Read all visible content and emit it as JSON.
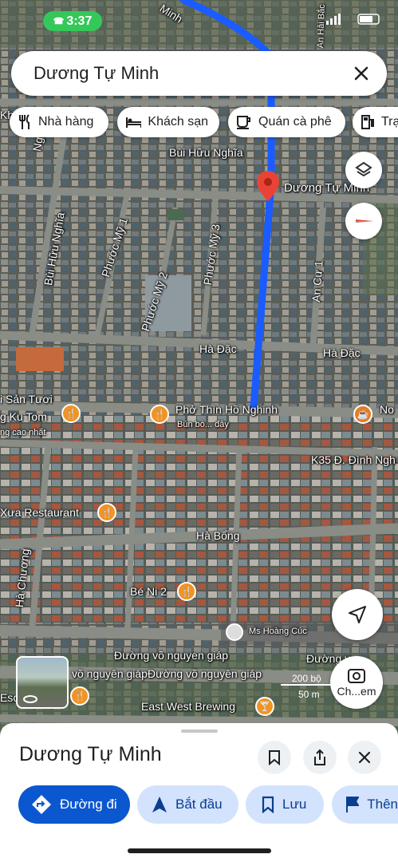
{
  "status": {
    "time": "3:37",
    "phone_icon": "phone-icon"
  },
  "search": {
    "query": "Dương Tự Minh"
  },
  "chips": [
    {
      "label": "Nhà hàng",
      "icon": "restaurant-icon"
    },
    {
      "label": "Khách sạn",
      "icon": "hotel-icon"
    },
    {
      "label": "Quán cà phê",
      "icon": "coffee-icon"
    },
    {
      "label": "Trạ",
      "icon": "gas-station-icon"
    }
  ],
  "map": {
    "pin_label": "Dương Tự Minh",
    "streets": {
      "top_road": "Minh",
      "top_right_road": "An Hải Bắc",
      "bui_huu_nghia_h": "Bùi Hữu Nghĩa",
      "bui_huu_nghia_v": "Bùi Hữu Nghĩa",
      "phuoc_my_1": "Phước Mỹ 1",
      "phuoc_my_2": "Phước Mỹ 2",
      "phuoc_my_3": "Phước Mỹ 3",
      "an_cu_1": "An Cư 1",
      "ha_dac_left": "Hà Đặc",
      "ha_dac_right": "Hà Đặc",
      "kh": "Kh",
      "ngo": "Ng",
      "k35": "K35 Đ. Đình Ngh",
      "ha_bong": "Hà Bổng",
      "ha_chuong": "Hà Chương",
      "vo_nguyen_giap_1": "Đường võ nguyen giáp",
      "vo_nguyen_giap_2": "võ nguyên giápĐường võ nguyên giáp",
      "vo_nguyen_giap_3": "Đường v",
      "vo_nguyen_giap_4": "guy",
      "esc": "Esc"
    },
    "places": {
      "hai_san": "i Sản Tươi",
      "ku_tom": "g Ku Tom",
      "cao_nhat": "ng cao nhất",
      "pho_thin": "Phở Thìn Hồ Nghinh",
      "pho_thin_sub": "Bún bò... đây",
      "no": "No",
      "xua": "Xưa Restaurant",
      "be_ni": "Bé Ni 2",
      "ms_hoang_cuc": "Ms Hoàng Cúc",
      "east_west": "East West Brewing"
    },
    "scale": {
      "ft": "200 bộ",
      "m": "50 m"
    },
    "thumbnail_icon": "360-street-view-icon",
    "lens_label": "Ch...em"
  },
  "sheet": {
    "title": "Dương Tự Minh",
    "actions": [
      {
        "label": "Đường đi",
        "icon": "directions-icon"
      },
      {
        "label": "Bắt đầu",
        "icon": "navigation-arrow-icon"
      },
      {
        "label": "Lưu",
        "icon": "bookmark-icon"
      },
      {
        "label": "Thên",
        "icon": "flag-icon"
      }
    ]
  },
  "colors": {
    "route": "#1a5cff",
    "pin": "#ea4335",
    "primary": "#0b57d0",
    "secondary": "#d3e3fd"
  }
}
